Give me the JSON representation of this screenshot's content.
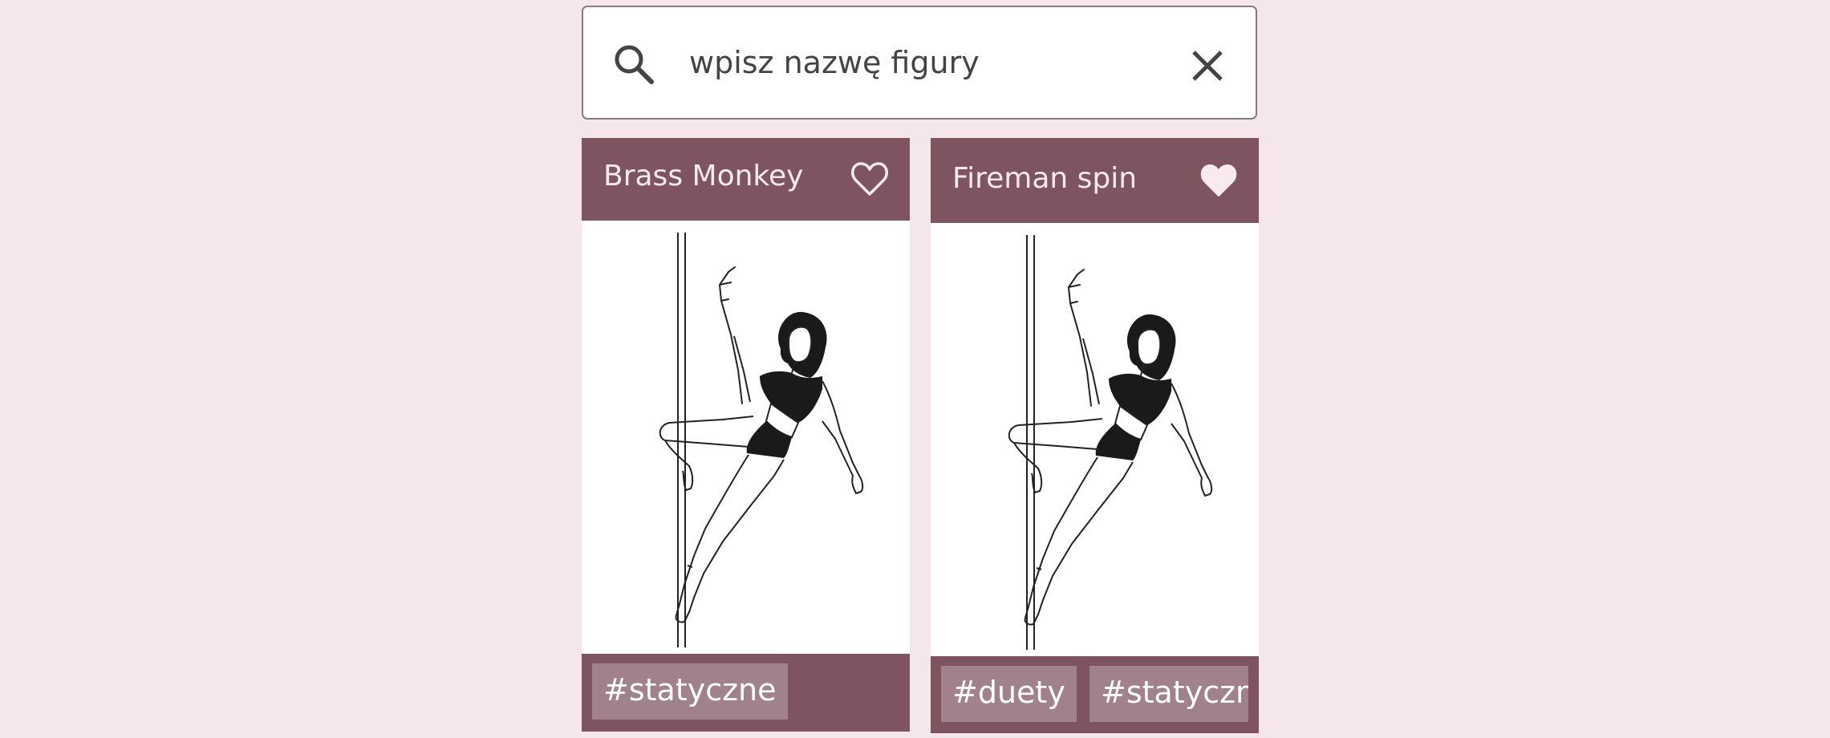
{
  "search": {
    "placeholder": "wpisz nazwę figury",
    "value": "",
    "icon": "search-icon",
    "clear_icon": "close-icon"
  },
  "cards": [
    {
      "title": "Brass Monkey",
      "favorite": false,
      "tags": [
        "#statyczne"
      ]
    },
    {
      "title": "Fireman spin",
      "favorite": true,
      "tags": [
        "#duety",
        "#statyczn"
      ]
    }
  ],
  "colors": {
    "background": "#f5e6ec",
    "card_bar": "#7e5461",
    "tag_bg": "#a1818b",
    "title_text": "#f8eaef"
  }
}
